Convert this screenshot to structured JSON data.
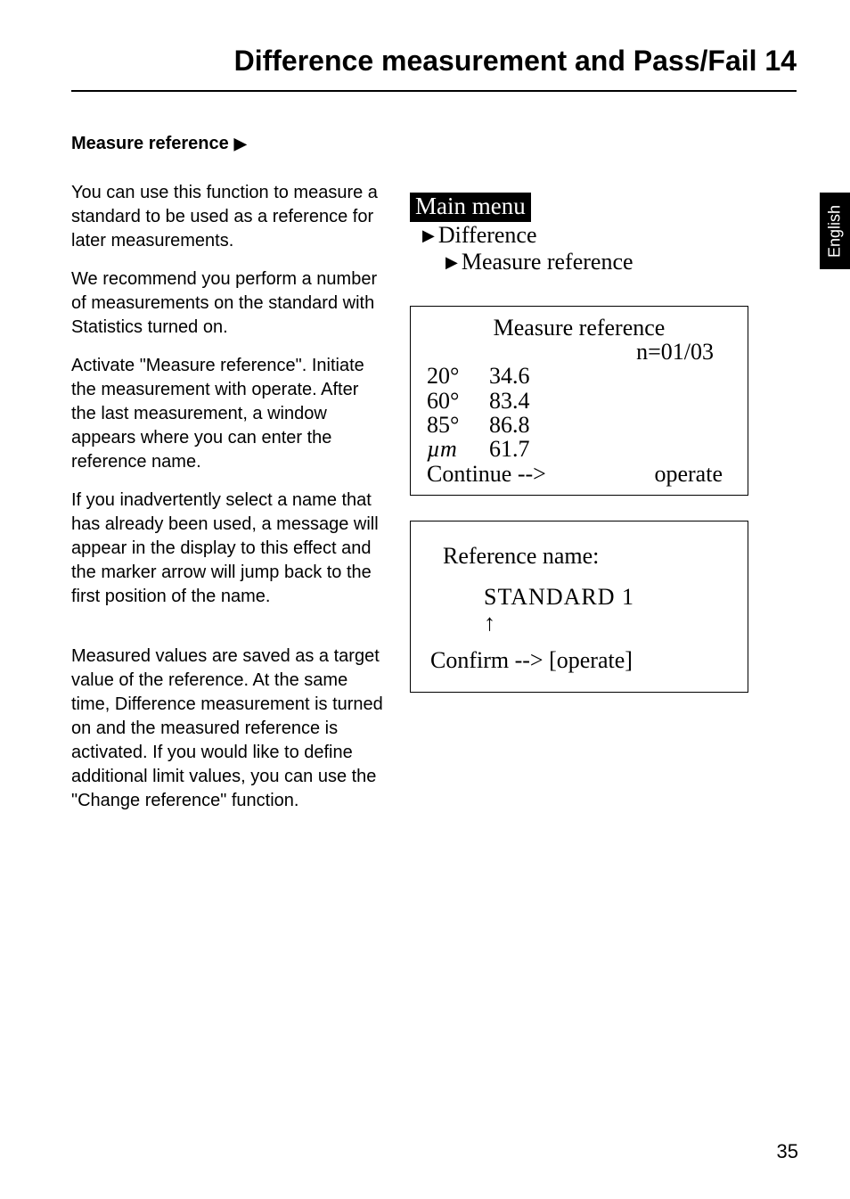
{
  "title": "Difference measurement and Pass/Fail 14",
  "side_tab": "English",
  "heading": {
    "text": "Measure reference",
    "marker": "▶"
  },
  "paras": {
    "p1": "You can use this function to measure a standard to be used as a reference for later measurements.",
    "p2": "We recommend you perform a number of measurements on the standard with Statistics turned on.",
    "p3": "Activate \"Measure reference\". Initiate the measurement with operate. After the last measurement, a window appears where you can enter the reference name.",
    "p4": "If you inadvertently select a name that has already been used, a message will appear in the display to this effect and the marker arrow will jump back to the first position of the name.",
    "p5": "Measured values are saved as a target value of the reference. At the same time, Difference measurement is turned on and the measured reference is activated. If you would like to define additional limit values, you can use the \"Change reference\" function."
  },
  "breadcrumb": {
    "root": "Main menu",
    "level1": "Difference",
    "level2": "Measure reference",
    "marker": "▶"
  },
  "lcd1": {
    "title": "Measure reference",
    "n": "n=01/03",
    "rows": [
      {
        "label": "20°",
        "value": "34.6"
      },
      {
        "label": "60°",
        "value": "83.4"
      },
      {
        "label": "85°",
        "value": "86.8"
      },
      {
        "label": "µm",
        "value": "61.7"
      }
    ],
    "continue_left": "Continue  -->",
    "continue_right": "operate"
  },
  "lcd2": {
    "title": "Reference name:",
    "name": "STANDARD  1",
    "arrow": "↑",
    "confirm": "Confirm --> [operate]"
  },
  "page_number": "35"
}
